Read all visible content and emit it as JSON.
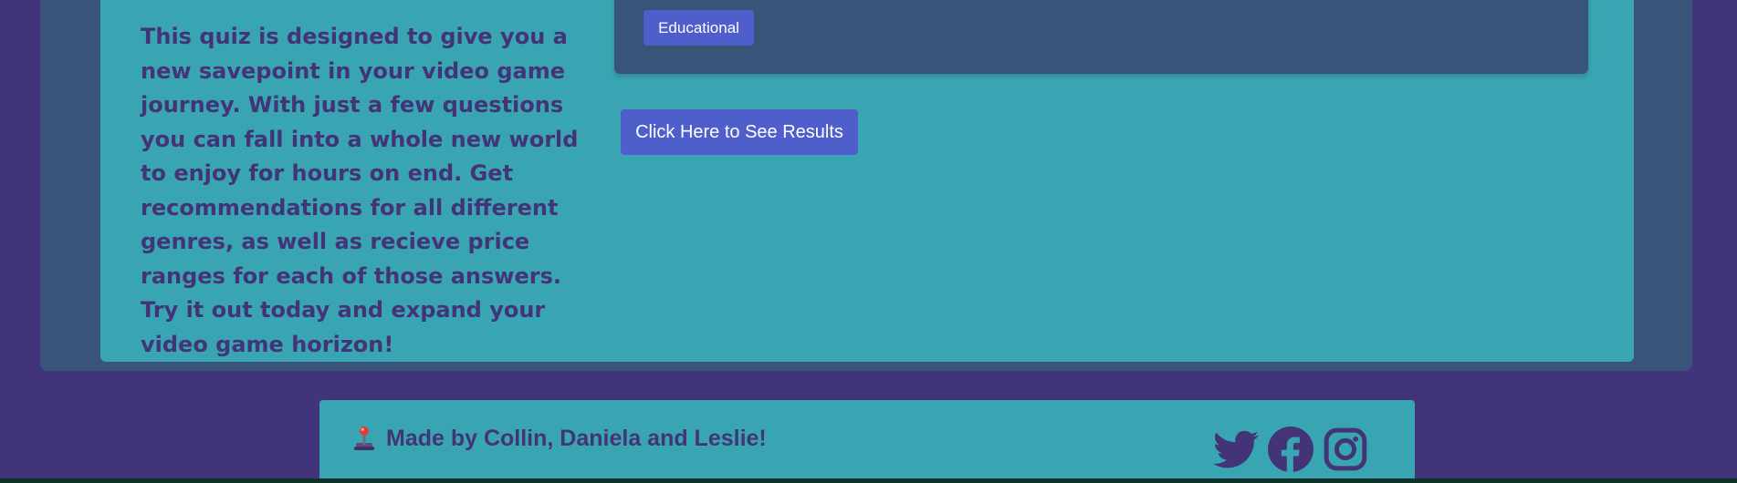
{
  "intro": {
    "text": "This quiz is designed to give you a new savepoint in your video game journey. With just a few questions you can fall into a whole new world to enjoy for hours on end. Get recommendations for all different genres, as well as recieve price ranges for each of those answers. Try it out today and expand your video game horizon!"
  },
  "quiz": {
    "answer_label": "Educational",
    "results_label": "Click Here to See Results"
  },
  "footer": {
    "credit_icon": "joystick-icon",
    "credit_text": "Made by Collin, Daniela and Leslie!",
    "socials": [
      {
        "name": "twitter-icon"
      },
      {
        "name": "facebook-icon"
      },
      {
        "name": "instagram-icon"
      }
    ]
  },
  "colors": {
    "page_background": "#42347a",
    "outer_panel": "#395379",
    "inner_panel": "#3aa5b2",
    "button": "#4e5ecb",
    "text": "#433477",
    "bottom_strip": "#0d3328"
  }
}
